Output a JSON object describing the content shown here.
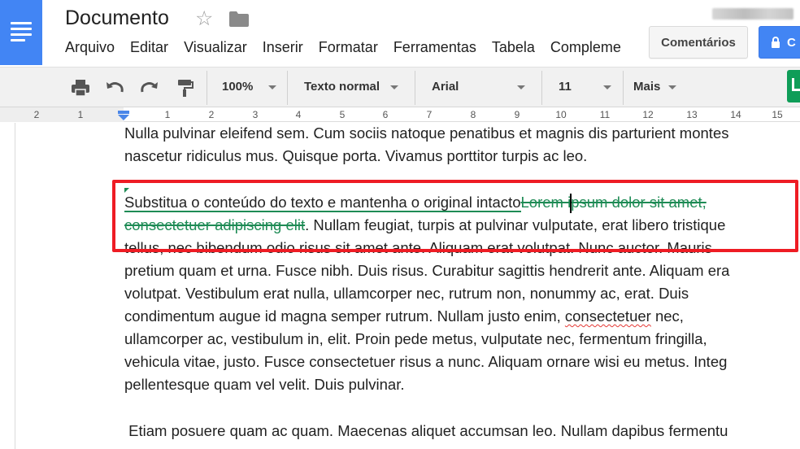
{
  "app": {
    "document_title": "Documento",
    "icons": [
      "docs-logo-icon",
      "star-icon",
      "folder-icon",
      "lock-icon"
    ]
  },
  "menu": {
    "items": [
      "Arquivo",
      "Editar",
      "Visualizar",
      "Inserir",
      "Formatar",
      "Ferramentas",
      "Tabela",
      "Compleme"
    ]
  },
  "header": {
    "comments_label": "Comentários",
    "share_label": "C"
  },
  "toolbar": {
    "zoom": "100%",
    "style": "Texto normal",
    "font": "Arial",
    "font_size": "11",
    "more": "Mais"
  },
  "ruler": {
    "labels": [
      "2",
      "1",
      "1",
      "2",
      "3",
      "4",
      "5",
      "6",
      "7",
      "8",
      "9",
      "10",
      "11",
      "12",
      "13",
      "14",
      "15"
    ]
  },
  "document": {
    "p1": {
      "line1": "Nulla pulvinar eleifend sem. Cum sociis natoque penatibus et magnis dis parturient montes",
      "line2": "nascetur ridiculus mus. Quisque porta. Vivamus porttitor turpis ac leo."
    },
    "p2": {
      "line1_inserted": "Substitua o conteúdo do texto e mantenha o original intacto",
      "line1_deleted": "Lorem ipsum dolor sit amet,",
      "line2_deleted": "consectetuer adipiscing elit",
      "line2_rest": ". Nullam feugiat, turpis at pulvinar vulputate, erat libero tristique",
      "line3": "tellus, nec bibendum odio risus sit amet ante. Aliquam erat volutpat. Nunc auctor. Mauris",
      "line4": "pretium quam et urna. Fusce nibh. Duis risus. Curabitur sagittis hendrerit ante. Aliquam era",
      "line5": "volutpat. Vestibulum erat nulla, ullamcorper nec, rutrum non, nonummy ac, erat. Duis",
      "line6_a": "condimentum augue id magna semper rutrum. Nullam justo enim, ",
      "line6_spell": "consectetuer",
      "line6_b": " nec,",
      "line7": "ullamcorper ac, vestibulum in, elit. Proin pede metus, vulputate nec, fermentum fringilla,",
      "line8": "vehicula vitae, justo. Fusce consectetuer risus a nunc. Aliquam ornare wisi eu metus. Integ",
      "line9": "pellentesque quam vel velit. Duis pulvinar."
    },
    "p3": {
      "line1": " Etiam posuere quam ac quam. Maecenas aliquet accumsan leo. Nullam dapibus fermentu"
    }
  },
  "colors": {
    "accent": "#4285f4",
    "suggestion_green": "#1e8b55",
    "highlight_red": "#ee1c24"
  }
}
